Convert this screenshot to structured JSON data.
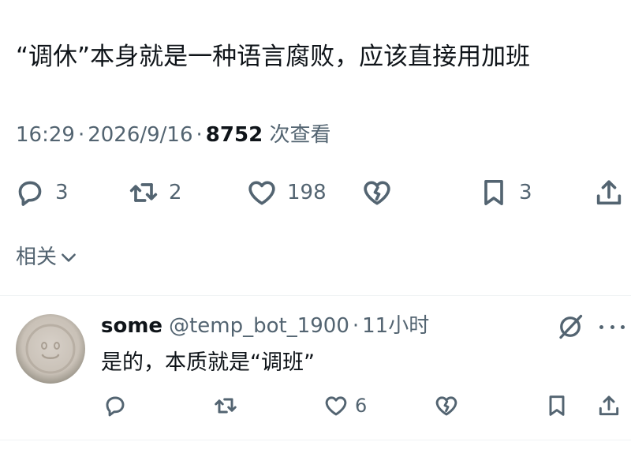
{
  "tweet": {
    "text": "“调休”本身就是一种语言腐败，应该直接用加班",
    "time": "16:29",
    "date": "2026/9/16",
    "views": "8752",
    "views_label": "次查看",
    "separator": "·"
  },
  "actions": {
    "reply_count": "3",
    "retweet_count": "2",
    "like_count": "198",
    "bookmark_count": "3"
  },
  "related": {
    "label": "相关"
  },
  "reply": {
    "name": "some",
    "handle": "@temp_bot_1900",
    "separator": "·",
    "time": "11小时",
    "text": "是的，本质就是“调班”",
    "like_count": "6"
  }
}
